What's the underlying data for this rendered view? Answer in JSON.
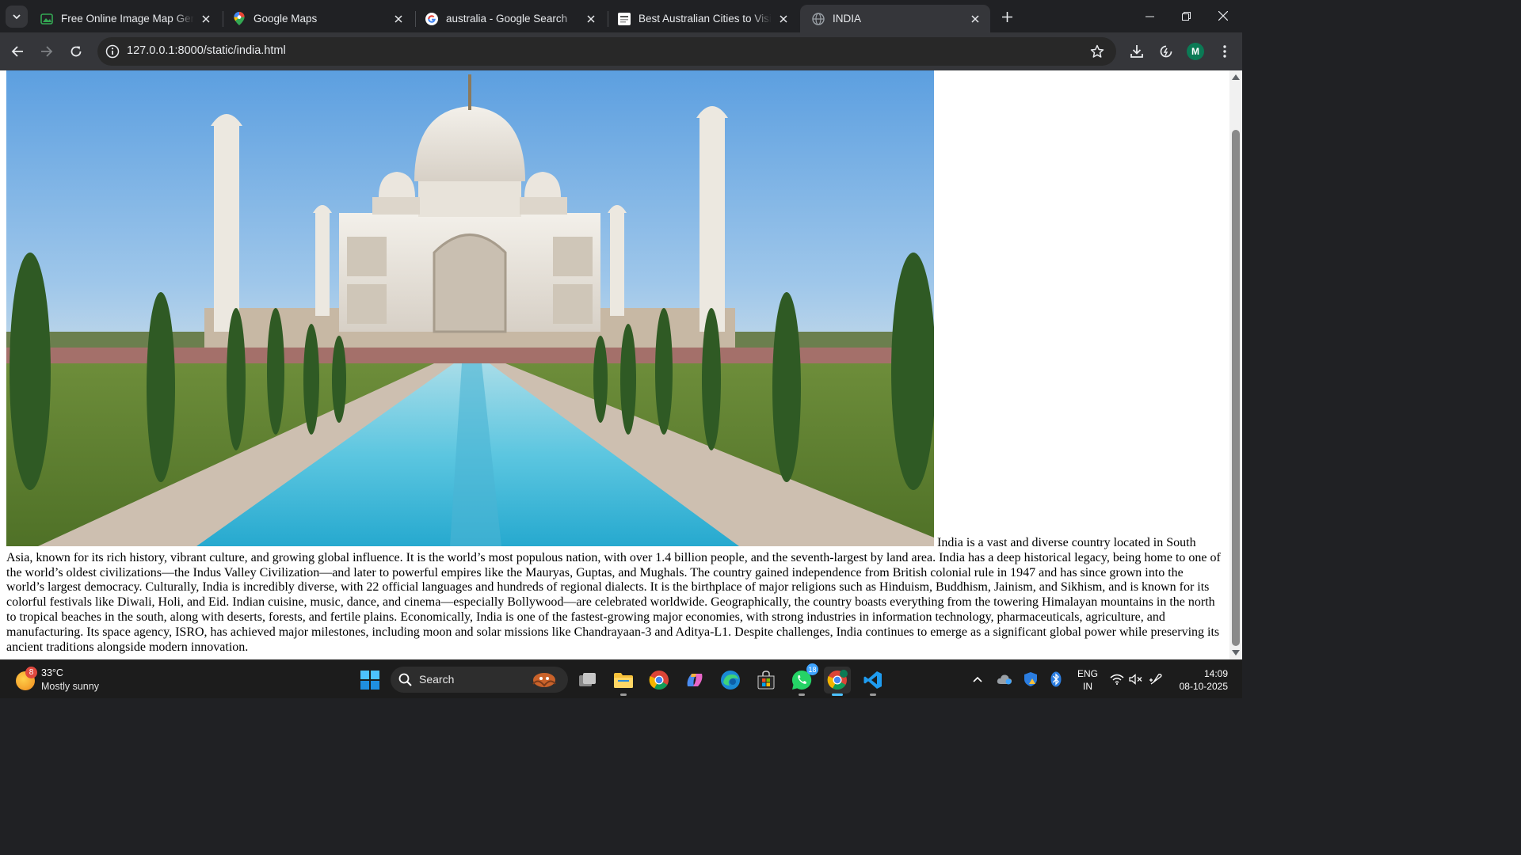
{
  "browser": {
    "tabs": [
      {
        "title": "Free Online Image Map Genera",
        "favicon": "image-map-favicon"
      },
      {
        "title": "Google Maps",
        "favicon": "google-maps-favicon"
      },
      {
        "title": "australia - Google Search",
        "favicon": "google-favicon"
      },
      {
        "title": "Best Australian Cities to Visit - E",
        "favicon": "website-favicon"
      },
      {
        "title": "INDIA",
        "favicon": "globe-favicon",
        "active": true
      }
    ],
    "url": "127.0.0.1:8000/static/india.html",
    "profile_initial": "M"
  },
  "page": {
    "image_subject": "Taj Mahal",
    "text": "India is a vast and diverse country located in South Asia, known for its rich history, vibrant culture, and growing global influence. It is the world’s most populous nation, with over 1.4 billion people, and the seventh-largest by land area. India has a deep historical legacy, being home to one of the world’s oldest civilizations—the Indus Valley Civilization—and later to powerful empires like the Mauryas, Guptas, and Mughals. The country gained independence from British colonial rule in 1947 and has since grown into the world’s largest democracy. Culturally, India is incredibly diverse, with 22 official languages and hundreds of regional dialects. It is the birthplace of major religions such as Hinduism, Buddhism, Jainism, and Sikhism, and is known for its colorful festivals like Diwali, Holi, and Eid. Indian cuisine, music, dance, and cinema—especially Bollywood—are celebrated worldwide. Geographically, the country boasts everything from the towering Himalayan mountains in the north to tropical beaches in the south, along with deserts, forests, and fertile plains. Economically, India is one of the fastest-growing major economies, with strong industries in information technology, pharmaceuticals, agriculture, and manufacturing. Its space agency, ISRO, has achieved major milestones, including moon and solar missions like Chandrayaan-3 and Aditya-L1. Despite challenges, India continues to emerge as a significant global power while preserving its ancient traditions alongside modern innovation."
  },
  "taskbar": {
    "weather": {
      "badge": "8",
      "temperature": "33°C",
      "condition": "Mostly sunny"
    },
    "search_label": "Search",
    "whatsapp_badge": "18",
    "language": {
      "line1": "ENG",
      "line2": "IN"
    },
    "clock": {
      "time": "14:09",
      "date": "08-10-2025"
    }
  },
  "colors": {
    "tab_strip": "#202124",
    "toolbar": "#35363a",
    "omnibox": "#282828",
    "taskbar": "#1c1c1c",
    "active_indicator": "#4cc2ff"
  }
}
